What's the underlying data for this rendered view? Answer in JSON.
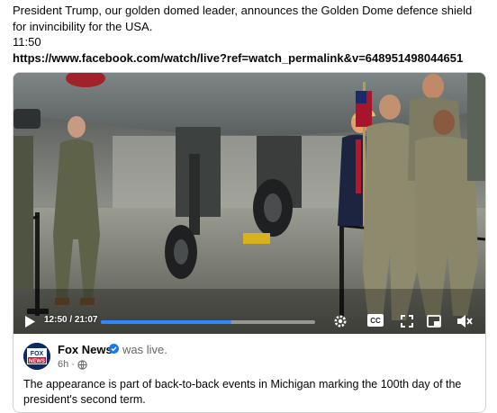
{
  "post": {
    "line1": "President Trump, our golden domed leader, announces the Golden Dome defence shield for invincibility for the USA.",
    "time": "11:50",
    "url": "https://www.facebook.com/watch/live?ref=watch_permalink&v=648951498044651"
  },
  "video": {
    "current_time": "12:50",
    "duration": "21:07",
    "time_separator": " / ",
    "progress": 0.61,
    "icons": [
      "play-icon",
      "settings-icon",
      "cc-icon",
      "fullscreen-icon",
      "picture-in-picture-icon",
      "volume-mute-icon"
    ],
    "cc_label": "CC"
  },
  "card": {
    "page_name": "Fox News",
    "avatar_text_line1": "FOX",
    "avatar_text_line2": "NEWS",
    "status": "was live.",
    "age": "6h",
    "separator": "·",
    "caption": "The appearance is part of back-to-back events in Michigan marking the 100th day of the president's second term.",
    "accent": "#2d88ff"
  }
}
